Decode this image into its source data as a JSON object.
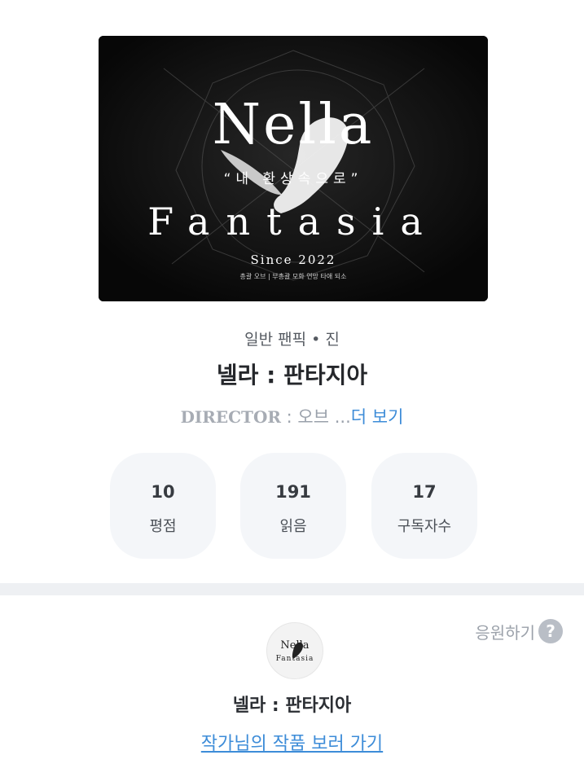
{
  "cover": {
    "title_line1": "Nella",
    "subtitle": "“내 환상속으로”",
    "title_line2": "Fantasia",
    "since": "Since 2022",
    "credit": "총괄 오브 | 부총괄 모화 연망 타애 되소"
  },
  "work": {
    "category": "일반 팬픽 • 진",
    "title": "넬라 : 판타지아",
    "description_label": "DIRECTOR",
    "description_rest": " : 오브 ...",
    "more_label": "더 보기"
  },
  "stats": [
    {
      "value": "10",
      "label": "평점"
    },
    {
      "value": "191",
      "label": "읽음"
    },
    {
      "value": "17",
      "label": "구독자수"
    }
  ],
  "author": {
    "support_label": "응원하기",
    "help_icon": "?",
    "avatar_line1": "Nella",
    "avatar_line2": "Fantasia",
    "name": "넬라 : 판타지아",
    "link_label": "작가님의 작품 보러 가기"
  },
  "colors": {
    "accent": "#3d8cd8",
    "stat_bg": "#f4f6f9",
    "divider": "#eef0f3"
  }
}
